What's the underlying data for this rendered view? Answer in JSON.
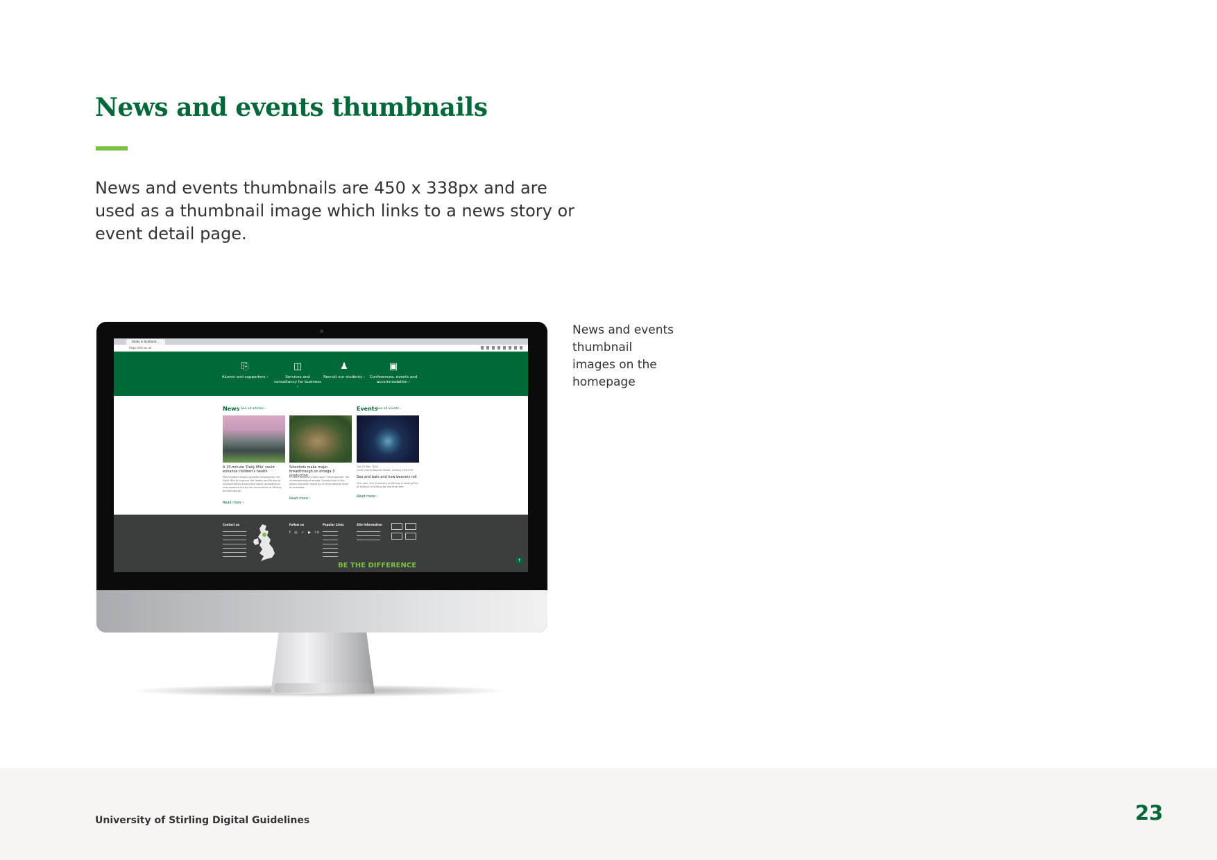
{
  "page": {
    "heading": "News and events thumbnails",
    "intro": "News and events thumbnails are 450 x 338px and are used as a thumbnail image which links to a news story or event detail page.",
    "caption": "News and events thumbnail images on the homepage",
    "footer_text": "University of Stirling Digital Guidelines",
    "page_number": "23"
  },
  "colors": {
    "brand_green": "#006938",
    "accent_green": "#7ac143",
    "footer_bg": "#f6f5f4"
  },
  "screen": {
    "tab_label": "Study in Scotland...",
    "url": "https://stir.ac.uk",
    "hero_items": [
      {
        "icon": "scroll-icon",
        "label": "Alumni and supporters ›"
      },
      {
        "icon": "briefcase-icon",
        "label": "Services and consultancy for business ›"
      },
      {
        "icon": "people-icon",
        "label": "Recruit our students ›"
      },
      {
        "icon": "presentation-icon",
        "label": "Conferences, events and accommodation ›"
      }
    ],
    "news": {
      "title": "News",
      "link": "See all articles ›",
      "cards": [
        {
          "title": "A 15-minute 'Daily Mile' could enhance children's health",
          "text": "Policymakers should consider introducing The Daily Mile to improve the health and fitness of schoolchildren around the world, according to new research led by the Universities of Stirling and Edinburgh.",
          "read_more": "Read more ›"
        },
        {
          "title": "Scientists make major breakthrough on omega-3 production",
          "text": "A major discovery that could \"revolutionise\" the understanding of omega-3 production in the ocean has been made by an international team of scientists.",
          "read_more": "Read more ›"
        }
      ]
    },
    "events": {
      "title": "Events",
      "link": "See all events ›",
      "card": {
        "date": "Tue 15 May 2018",
        "location": "Colin Craven Barrow Street, Stirling, FK8 1HH",
        "title": "Sea and bats and how beavers roll",
        "text": "This year, the University of Stirling is hosting Pint of Science in Stirling for the first time.",
        "read_more": "Read more ›"
      }
    },
    "footer": {
      "contact": "Contact us",
      "follow": "Follow us",
      "popular": "Popular Links",
      "site_info": "Site Information",
      "tagline": "BE THE DIFFERENCE",
      "top_icon": "↑"
    }
  }
}
